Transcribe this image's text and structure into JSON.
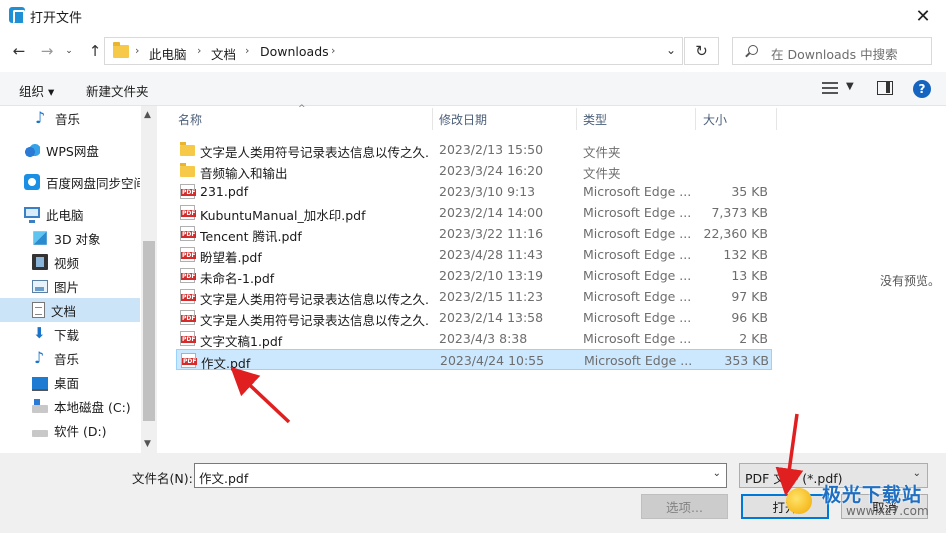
{
  "window": {
    "title": "打开文件",
    "close_glyph": "✕"
  },
  "nav": {
    "back": "←",
    "forward": "→",
    "recent": "⌄",
    "up": "↑",
    "breadcrumbs": [
      "此电脑",
      "文档",
      "Downloads"
    ],
    "refresh": "↻",
    "search_placeholder": "在 Downloads 中搜索"
  },
  "toolbar": {
    "organize": "组织 ▾",
    "new_folder": "新建文件夹",
    "help": "?"
  },
  "sidebar": {
    "items": [
      {
        "label": "音乐",
        "icon": "music-icon"
      },
      {
        "label": "WPS网盘",
        "icon": "cloud-icon"
      },
      {
        "label": "百度网盘同步空间",
        "icon": "baidu-cloud-icon"
      },
      {
        "label": "此电脑",
        "icon": "computer-icon"
      },
      {
        "label": "3D 对象",
        "icon": "3d-objects-icon"
      },
      {
        "label": "视频",
        "icon": "video-icon"
      },
      {
        "label": "图片",
        "icon": "pictures-icon"
      },
      {
        "label": "文档",
        "icon": "documents-icon",
        "selected": true
      },
      {
        "label": "下载",
        "icon": "downloads-icon"
      },
      {
        "label": "音乐",
        "icon": "music-icon"
      },
      {
        "label": "桌面",
        "icon": "desktop-icon"
      },
      {
        "label": "本地磁盘 (C:)",
        "icon": "disk-icon"
      },
      {
        "label": "软件 (D:)",
        "icon": "disk-icon"
      }
    ]
  },
  "columns": {
    "name": "名称",
    "date": "修改日期",
    "type": "类型",
    "size": "大小"
  },
  "files": [
    {
      "name": "文字是人类用符号记录表达信息以传之久...",
      "date": "2023/2/13 15:50",
      "type": "文件夹",
      "size": "",
      "kind": "folder"
    },
    {
      "name": "音频输入和输出",
      "date": "2023/3/24 16:20",
      "type": "文件夹",
      "size": "",
      "kind": "folder"
    },
    {
      "name": "231.pdf",
      "date": "2023/3/10 9:13",
      "type": "Microsoft Edge ...",
      "size": "35 KB",
      "kind": "pdf"
    },
    {
      "name": "KubuntuManual_加水印.pdf",
      "date": "2023/2/14 14:00",
      "type": "Microsoft Edge ...",
      "size": "7,373 KB",
      "kind": "pdf"
    },
    {
      "name": "Tencent 腾讯.pdf",
      "date": "2023/3/22 11:16",
      "type": "Microsoft Edge ...",
      "size": "22,360 KB",
      "kind": "pdf"
    },
    {
      "name": "盼望着.pdf",
      "date": "2023/4/28 11:43",
      "type": "Microsoft Edge ...",
      "size": "132 KB",
      "kind": "pdf"
    },
    {
      "name": "未命名-1.pdf",
      "date": "2023/2/10 13:19",
      "type": "Microsoft Edge ...",
      "size": "13 KB",
      "kind": "pdf"
    },
    {
      "name": "文字是人类用符号记录表达信息以传之久...",
      "date": "2023/2/15 11:23",
      "type": "Microsoft Edge ...",
      "size": "97 KB",
      "kind": "pdf"
    },
    {
      "name": "文字是人类用符号记录表达信息以传之久...",
      "date": "2023/2/14 13:58",
      "type": "Microsoft Edge ...",
      "size": "96 KB",
      "kind": "pdf"
    },
    {
      "name": "文字文稿1.pdf",
      "date": "2023/4/3 8:38",
      "type": "Microsoft Edge ...",
      "size": "2 KB",
      "kind": "pdf"
    },
    {
      "name": "作文.pdf",
      "date": "2023/4/24 10:55",
      "type": "Microsoft Edge ...",
      "size": "353 KB",
      "kind": "pdf",
      "selected": true
    }
  ],
  "preview": {
    "message": "没有预览。"
  },
  "bottom": {
    "filename_label": "文件名(N):",
    "filename_value": "作文.pdf",
    "filetype_value": "PDF 文件 (*.pdf)",
    "options_button": "选项...",
    "open_button": "打开",
    "cancel_button": "取消"
  },
  "watermark": {
    "text": "极光下载站",
    "url": "www.xz7.com"
  },
  "annotation_color": "#e02020"
}
